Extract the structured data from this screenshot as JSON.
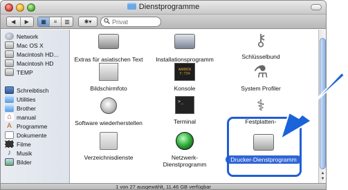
{
  "window": {
    "title": "Dienstprogramme",
    "status": "1 von 27 ausgewählt, 11.46 GB verfügbar"
  },
  "toolbar": {
    "back_icon": "◀",
    "forward_icon": "▶",
    "view_icon_view": "▦",
    "view_list": "≡",
    "view_columns": "▥",
    "action_icon": "✱▾",
    "search_placeholder": "Privat"
  },
  "sidebar": {
    "devices": [
      {
        "label": "Network",
        "icon": "network-icon"
      },
      {
        "label": "Mac OS X",
        "icon": "hard-disk-icon"
      },
      {
        "label": "Macintosh HD...",
        "icon": "hard-disk-icon"
      },
      {
        "label": "Macintosh HD",
        "icon": "hard-disk-icon"
      },
      {
        "label": "TEMP",
        "icon": "hard-disk-icon"
      }
    ],
    "places": [
      {
        "label": "Schreibtisch",
        "icon": "desktop-icon"
      },
      {
        "label": "Utilities",
        "icon": "folder-icon"
      },
      {
        "label": "Brother",
        "icon": "folder-icon"
      },
      {
        "label": "manual",
        "icon": "home-icon"
      },
      {
        "label": "Programme",
        "icon": "applications-icon"
      },
      {
        "label": "Dokumente",
        "icon": "documents-icon"
      },
      {
        "label": "Filme",
        "icon": "movies-icon"
      },
      {
        "label": "Musik",
        "icon": "music-icon"
      },
      {
        "label": "Bilder",
        "icon": "pictures-icon"
      }
    ]
  },
  "items": [
    {
      "label": "Extras für asiatischen Text",
      "icon": "asian-text-extras-icon",
      "selected": false
    },
    {
      "label": "Installationsprogramm",
      "icon": "installer-icon",
      "selected": false
    },
    {
      "label": "Schlüsselbund",
      "icon": "keychain-icon",
      "selected": false
    },
    {
      "label": "Bildschirmfoto",
      "icon": "screenshot-icon",
      "selected": false
    },
    {
      "label": "Konsole",
      "icon": "console-icon",
      "selected": false
    },
    {
      "label": "System Profiler",
      "icon": "system-profiler-icon",
      "selected": false
    },
    {
      "label": "Software wiederherstellen",
      "icon": "software-restore-icon",
      "selected": false
    },
    {
      "label": "Terminal",
      "icon": "terminal-icon",
      "selected": false
    },
    {
      "label": "Festplatten-Dienstprogramm",
      "icon": "disk-utility-icon",
      "selected": false
    },
    {
      "label": "Verzeichnisdienste",
      "icon": "directory-services-icon",
      "selected": false
    },
    {
      "label": "Netzwerk-Dienstprogramm",
      "icon": "network-utility-icon",
      "selected": false
    },
    {
      "label": "Drucker-Dienstprogramm",
      "icon": "printer-utility-icon",
      "selected": true
    }
  ],
  "colors": {
    "selection": "#2f65d6",
    "highlight_frame": "#1f5dd8",
    "arrow": "#1a63d8"
  },
  "console_text": "WARNIN\nY:734"
}
